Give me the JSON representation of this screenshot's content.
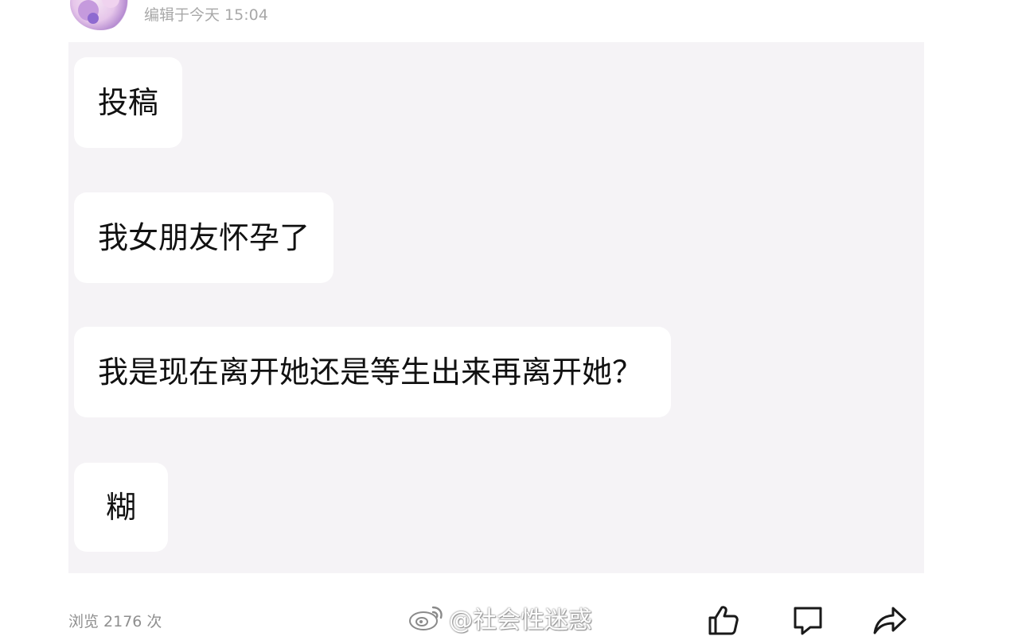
{
  "header": {
    "edit_meta": "编辑于今天 15:04"
  },
  "messages": [
    {
      "text": "投稿"
    },
    {
      "text": "我女朋友怀孕了"
    },
    {
      "text": "我是现在离开她还是等生出来再离开她？"
    },
    {
      "text": "糊"
    }
  ],
  "footer": {
    "views": "浏览 2176 次",
    "watermark": "@社会性迷惑",
    "actions": [
      {
        "icon": "thumbs-up-icon"
      },
      {
        "icon": "comment-icon"
      },
      {
        "icon": "share-icon"
      }
    ]
  }
}
